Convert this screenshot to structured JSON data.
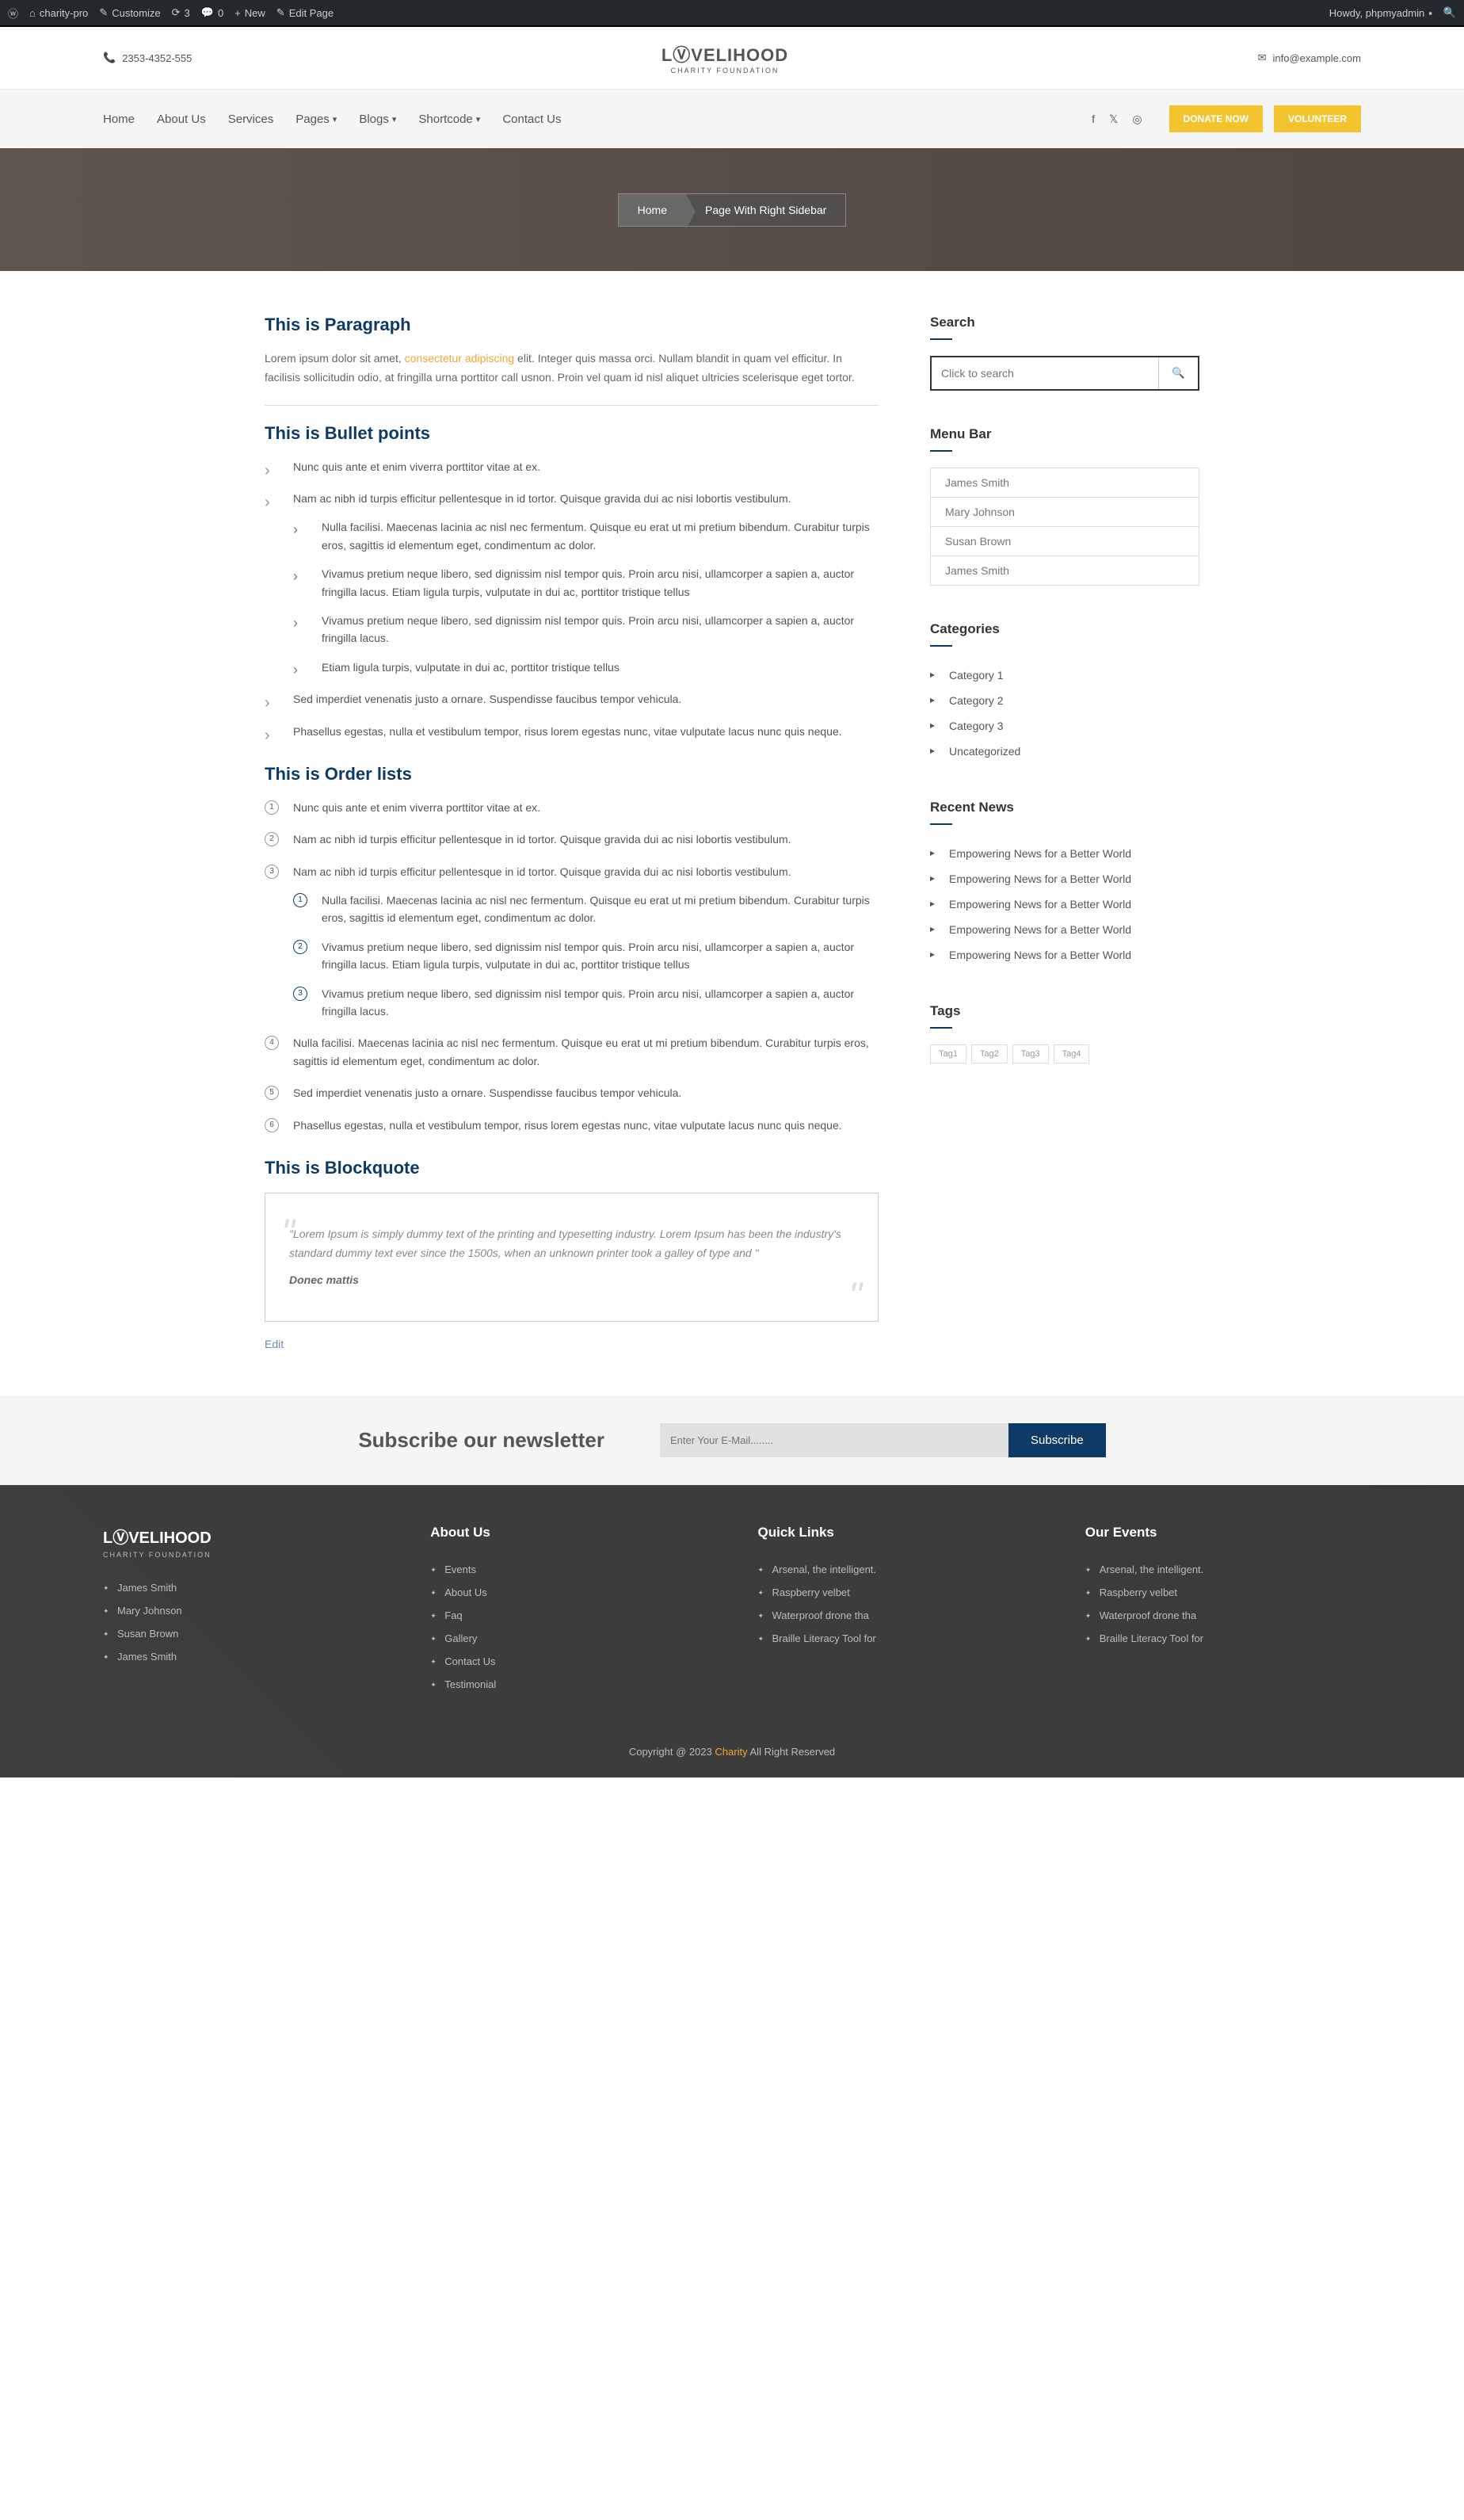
{
  "admin": {
    "site": "charity-pro",
    "customize": "Customize",
    "updates": "3",
    "comments": "0",
    "new": "New",
    "edit": "Edit Page",
    "howdy": "Howdy, phpmyadmin"
  },
  "topbar": {
    "phone": "2353-4352-555",
    "email": "info@example.com"
  },
  "logo": {
    "main": "LⓋVELIHOOD",
    "sub": "CHARITY FOUNDATION"
  },
  "nav": [
    "Home",
    "About Us",
    "Services",
    "Pages",
    "Blogs",
    "Shortcode",
    "Contact Us"
  ],
  "buttons": {
    "donate": "DONATE NOW",
    "volunteer": "VOLUNTEER",
    "subscribe": "Subscribe"
  },
  "breadcrumb": {
    "home": "Home",
    "current": "Page With Right Sidebar"
  },
  "headings": {
    "para": "This is Paragraph",
    "bullet": "This is Bullet points",
    "order": "This is Order lists",
    "quote": "This is Blockquote"
  },
  "para": {
    "t1": "Lorem ipsum dolor sit amet, ",
    "link": "consectetur adipiscing",
    "t2": " elit. Integer quis massa orci. Nullam blandit in quam vel efficitur. In facilisis sollicitudin odio, at fringilla urna porttitor call usnon. Proin vel quam id nisl aliquet ultricies scelerisque eget tortor."
  },
  "bullets": {
    "i1": "Nunc quis ante et enim viverra porttitor vitae at ex.",
    "i2": "Nam ac nibh id turpis efficitur pellentesque in id tortor. Quisque gravida dui ac nisi lobortis vestibulum.",
    "n1": "Nulla facilisi. Maecenas lacinia ac nisl nec fermentum. Quisque eu erat ut mi pretium bibendum. Curabitur turpis eros, sagittis id elementum eget, condimentum ac dolor.",
    "n2": "Vivamus pretium neque libero, sed dignissim nisl tempor quis. Proin arcu nisi, ullamcorper a sapien a, auctor fringilla lacus. Etiam ligula turpis, vulputate in dui ac, porttitor tristique tellus",
    "n3": "Vivamus pretium neque libero, sed dignissim nisl tempor quis. Proin arcu nisi, ullamcorper a sapien a, auctor fringilla lacus.",
    "n4": "Etiam ligula turpis, vulputate in dui ac, porttitor tristique tellus",
    "i3": "Sed imperdiet venenatis justo a ornare. Suspendisse faucibus tempor vehicula.",
    "i4": "Phasellus egestas, nulla et vestibulum tempor, risus lorem egestas nunc, vitae vulputate lacus nunc quis neque."
  },
  "orders": {
    "i1": "Nunc quis ante et enim viverra porttitor vitae at ex.",
    "i2": "Nam ac nibh id turpis efficitur pellentesque in id tortor. Quisque gravida dui ac nisi lobortis vestibulum.",
    "i3": "Nam ac nibh id turpis efficitur pellentesque in id tortor. Quisque gravida dui ac nisi lobortis vestibulum.",
    "n1": "Nulla facilisi. Maecenas lacinia ac nisl nec fermentum. Quisque eu erat ut mi pretium bibendum. Curabitur turpis eros, sagittis id elementum eget, condimentum ac dolor.",
    "n2": "Vivamus pretium neque libero, sed dignissim nisl tempor quis. Proin arcu nisi, ullamcorper a sapien a, auctor fringilla lacus. Etiam ligula turpis, vulputate in dui ac, porttitor tristique tellus",
    "n3": "Vivamus pretium neque libero, sed dignissim nisl tempor quis. Proin arcu nisi, ullamcorper a sapien a, auctor fringilla lacus.",
    "i4": "Nulla facilisi. Maecenas lacinia ac nisl nec fermentum. Quisque eu erat ut mi pretium bibendum. Curabitur turpis eros, sagittis id elementum eget, condimentum ac dolor.",
    "i5": "Sed imperdiet venenatis justo a ornare. Suspendisse faucibus tempor vehicula.",
    "i6": "Phasellus egestas, nulla et vestibulum tempor, risus lorem egestas nunc, vitae vulputate lacus nunc quis neque."
  },
  "quote": {
    "text": "\"Lorem Ipsum is simply dummy text of the printing and typesetting industry. Lorem Ipsum has been the industry's standard dummy text ever since the 1500s, when an unknown printer took a galley of type and \"",
    "cite": "Donec mattis"
  },
  "edit": "Edit",
  "widgets": {
    "search": {
      "title": "Search",
      "placeholder": "Click to search"
    },
    "menu": {
      "title": "Menu Bar",
      "items": [
        "James Smith",
        "Mary Johnson",
        "Susan Brown",
        "James Smith"
      ]
    },
    "cat": {
      "title": "Categories",
      "items": [
        "Category 1",
        "Category 2",
        "Category 3",
        "Uncategorized"
      ]
    },
    "news": {
      "title": "Recent News",
      "items": [
        "Empowering News for a Better World",
        "Empowering News for a Better World",
        "Empowering News for a Better World",
        "Empowering News for a Better World",
        "Empowering News for a Better World"
      ]
    },
    "tags": {
      "title": "Tags",
      "items": [
        "Tag1",
        "Tag2",
        "Tag3",
        "Tag4"
      ]
    }
  },
  "newsletter": {
    "title": "Subscribe our newsletter",
    "placeholder": "Enter Your E-Mail........"
  },
  "footer": {
    "col1": {
      "items": [
        "James Smith",
        "Mary Johnson",
        "Susan Brown",
        "James Smith"
      ]
    },
    "col2": {
      "title": "About Us",
      "items": [
        "Events",
        "About Us",
        "Faq",
        "Gallery",
        "Contact Us",
        "Testimonial"
      ]
    },
    "col3": {
      "title": "Quick Links",
      "items": [
        "Arsenal, the intelligent.",
        "Raspberry velbet",
        "Waterproof drone tha",
        "Braille Literacy Tool for"
      ]
    },
    "col4": {
      "title": "Our Events",
      "items": [
        "Arsenal, the intelligent.",
        "Raspberry velbet",
        "Waterproof drone tha",
        "Braille Literacy Tool for"
      ]
    },
    "copy": {
      "t1": "Copyright @ 2023 ",
      "link": "Charity",
      "t2": " All Right Reserved"
    }
  }
}
